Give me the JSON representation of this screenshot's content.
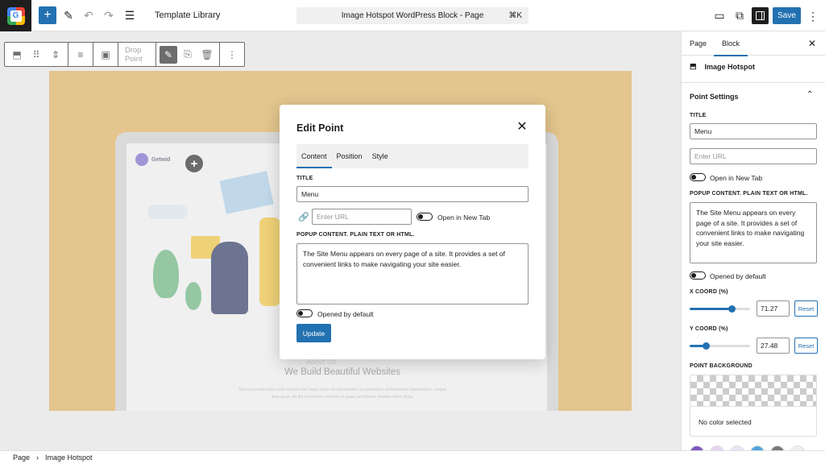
{
  "topbar": {
    "template_library": "Template Library",
    "command_bar": "Image Hotspot WordPress Block - Page",
    "command_shortcut": "⌘K",
    "save_label": "Save"
  },
  "block_toolbar": {
    "drop_point_label": "Drop Point"
  },
  "canvas": {
    "brand": "Getwid",
    "hero_about": "About Us",
    "hero_title": "We Build Beautiful Websites",
    "hero_sub": "Sed ut perspiciatis unde omnis iste natus error sit voluptatem accusantium doloremque laudantium, eaque ipsa quae ab illo inventore veritatis et quasi architecto beatae vitae dicta."
  },
  "modal": {
    "title": "Edit Point",
    "tabs": [
      "Content",
      "Position",
      "Style"
    ],
    "active_tab": "Content",
    "title_label": "TITLE",
    "title_value": "Menu",
    "url_placeholder": "Enter URL",
    "new_tab_label": "Open in New Tab",
    "popup_label": "POPUP CONTENT. PLAIN TEXT OR HTML.",
    "popup_value": "The Site Menu appears on every page of a site. It provides a set of convenient links to make navigating your site easier.",
    "opened_default_label": "Opened by default",
    "update_label": "Update"
  },
  "sidebar": {
    "tabs": [
      "Page",
      "Block"
    ],
    "active_tab": "Block",
    "block_name": "Image Hotspot",
    "section_title": "Point Settings",
    "title_label": "TITLE",
    "title_value": "Menu",
    "url_placeholder": "Enter URL",
    "new_tab_label": "Open in New Tab",
    "popup_label": "POPUP CONTENT. PLAIN TEXT OR HTML.",
    "popup_value": "The Site Menu appears on every page of a site. It provides a set of convenient links to make navigating your site easier.",
    "opened_default_label": "Opened by default",
    "x_label": "X COORD (%)",
    "x_value": "71.27",
    "y_label": "Y COORD (%)",
    "y_value": "27.48",
    "reset_label": "Reset",
    "bg_label": "POINT BACKGROUND",
    "no_color": "No color selected",
    "swatches": [
      "#7e57c2",
      "#e8d5f0",
      "#e6e6f5",
      "#54a6e0",
      "#7a7a7a",
      "#f0f0f0"
    ]
  },
  "statusbar": {
    "crumbs": [
      "Page",
      "Image Hotspot"
    ],
    "separator": "›"
  },
  "colors": {
    "accent": "#2271b1",
    "canvas_yellow": "#d4a650"
  }
}
